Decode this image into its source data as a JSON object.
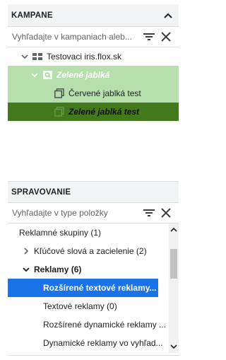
{
  "campaigns_panel": {
    "title": "KAMPANE",
    "search_placeholder": "Vyhľadajte v kampaniach aleb...",
    "tree": {
      "account": "Testovaci iris.flox.sk",
      "campaign": "Zelené jablká",
      "ad_groups": [
        "Červené jablká test",
        "Zelené jablká test"
      ]
    }
  },
  "manage_panel": {
    "title": "SPRAVOVANIE",
    "search_placeholder": "Vyhľadajte v type položky",
    "items": {
      "ad_groups": "Reklamné skupiny (1)",
      "keywords": "Kľúčové slová a zacielenie (2)",
      "ads": "Reklamy (6)",
      "responsive_search_ads": "Rozšírené textové reklamy...",
      "text_ads": "Textové reklamy (0)",
      "dynamic_search_ads": "Rozšírené dynamické reklamy ...",
      "search_network_ads": "Dynamické reklamy vo vyhľad..."
    }
  },
  "colors": {
    "campaign_highlight": "#b7dfae",
    "selected_adgroup": "#43781c",
    "selected_item": "#1a73e8"
  }
}
